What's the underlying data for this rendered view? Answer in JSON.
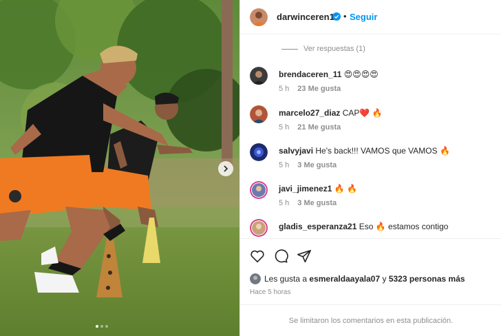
{
  "post": {
    "author": "darwinceren17",
    "separator": "•",
    "follow_label": "Seguir",
    "carousel": {
      "total_slides": 3,
      "active_slide": 1
    }
  },
  "replies_label": "Ver respuestas (1)",
  "comments": [
    {
      "user": "brendaceren_11",
      "text": "😍😍😍😍",
      "time": "5 h",
      "likes": "23 Me gusta",
      "avatar_color": "#3b3b3b"
    },
    {
      "user": "marcelo27_diaz",
      "text": "CAP❤️ 🔥",
      "time": "5 h",
      "likes": "21 Me gusta",
      "avatar_color": "#b0553a"
    },
    {
      "user": "salvyjavi",
      "text": "He's back!!! VAMOS que VAMOS 🔥",
      "time": "5 h",
      "likes": "3 Me gusta",
      "avatar_color": "#1f2a6b"
    },
    {
      "user": "javi_jimenez1",
      "text": "🔥 🔥",
      "time": "5 h",
      "likes": "3 Me gusta",
      "avatar_color": "#6b7bb0"
    },
    {
      "user": "gladis_esperanza21",
      "text": "Eso 🔥 estamos contigo",
      "time": "",
      "likes": "",
      "avatar_color": "#c9a27a"
    }
  ],
  "likes_summary": {
    "prefix": "Les gusta a",
    "user": "esmeraldaayala07",
    "connector": "y",
    "others": "5323 personas más"
  },
  "posted_ago": "Hace 5 horas",
  "comments_limited": "Se limitaron los comentarios en esta publicación.",
  "colors": {
    "accent": "#0095f6",
    "verified": "#0095f6",
    "muted": "#8e8e8e",
    "text": "#262626"
  },
  "icons": [
    "chevron-right-icon",
    "verified-icon",
    "heart-icon",
    "comment-icon",
    "share-icon"
  ]
}
